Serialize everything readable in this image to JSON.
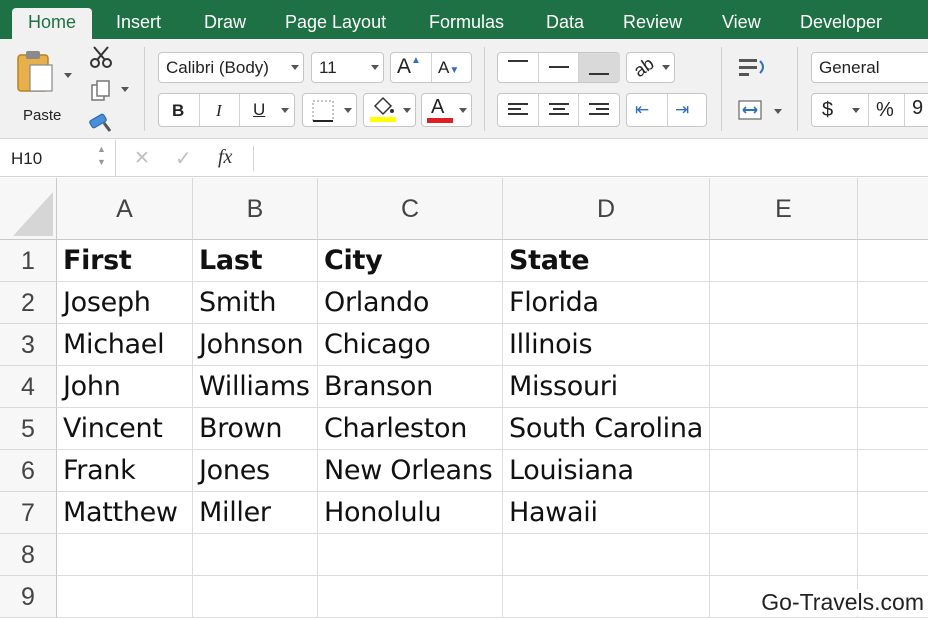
{
  "tabs": [
    "Home",
    "Insert",
    "Draw",
    "Page Layout",
    "Formulas",
    "Data",
    "Review",
    "View",
    "Developer"
  ],
  "active_tab": "Home",
  "ribbon": {
    "paste_label": "Paste",
    "font_name": "Calibri (Body)",
    "font_size": "11",
    "bold": "B",
    "italic": "I",
    "underline": "U",
    "number_format": "General",
    "currency": "$",
    "percent": "%",
    "grow_font": "A",
    "shrink_font": "A",
    "font_color_letter": "A"
  },
  "formula_bar": {
    "name_box": "H10",
    "cancel": "✕",
    "enter": "✓",
    "fx": "fx",
    "value": ""
  },
  "grid": {
    "columns": [
      "A",
      "B",
      "C",
      "D",
      "E"
    ],
    "rows": [
      "1",
      "2",
      "3",
      "4",
      "5",
      "6",
      "7",
      "8",
      "9"
    ],
    "cells": [
      [
        "First",
        "Last",
        "City",
        "State",
        ""
      ],
      [
        "Joseph",
        "Smith",
        "Orlando",
        "Florida",
        ""
      ],
      [
        "Michael",
        "Johnson",
        "Chicago",
        "Illinois",
        ""
      ],
      [
        "John",
        "Williams",
        "Branson",
        "Missouri",
        ""
      ],
      [
        "Vincent",
        "Brown",
        "Charleston",
        "South Carolina",
        ""
      ],
      [
        "Frank",
        "Jones",
        "New Orleans",
        "Louisiana",
        ""
      ],
      [
        "Matthew",
        "Miller",
        "Honolulu",
        "Hawaii",
        ""
      ],
      [
        "",
        "",
        "",
        "",
        ""
      ],
      [
        "",
        "",
        "",
        "",
        ""
      ]
    ]
  },
  "watermark": "Go-Travels.com",
  "colors": {
    "tab_bar": "#1e7145",
    "ribbon_bg": "#f1f1f1",
    "highlight_yellow": "#ffff00",
    "font_red": "#e02020"
  }
}
